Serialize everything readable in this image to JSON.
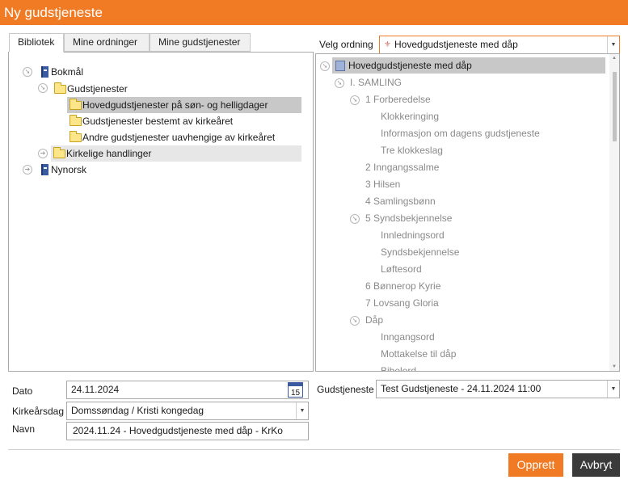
{
  "window": {
    "title": "Ny gudstjeneste"
  },
  "tabs": [
    {
      "label": "Bibliotek"
    },
    {
      "label": "Mine ordninger"
    },
    {
      "label": "Mine gudstjenester"
    }
  ],
  "library_tree": [
    {
      "label": "Bokmål"
    },
    {
      "label": "Gudstjenester"
    },
    {
      "label": "Hovedgudstjenester på søn- og helligdager"
    },
    {
      "label": "Gudstjenester bestemt av kirkeåret"
    },
    {
      "label": "Andre gudstjenester uavhengige av kirkeåret"
    },
    {
      "label": "Kirkelige handlinger"
    },
    {
      "label": "Nynorsk"
    }
  ],
  "ordning": {
    "label": "Velg ordning",
    "selected": "Hovedgudstjeneste med dåp"
  },
  "order_tree": [
    {
      "label": "Hovedgudstjeneste med dåp"
    },
    {
      "label": "I. SAMLING"
    },
    {
      "label": "1 Forberedelse"
    },
    {
      "label": "Klokkeringing"
    },
    {
      "label": "Informasjon om dagens gudstjeneste"
    },
    {
      "label": "Tre klokkeslag"
    },
    {
      "label": "2 Inngangssalme"
    },
    {
      "label": "3 Hilsen"
    },
    {
      "label": "4 Samlingsbønn"
    },
    {
      "label": "5 Syndsbekjennelse"
    },
    {
      "label": "Innledningsord"
    },
    {
      "label": "Syndsbekjennelse"
    },
    {
      "label": "Løftesord"
    },
    {
      "label": "6 Bønnerop Kyrie"
    },
    {
      "label": "7 Lovsang Gloria"
    },
    {
      "label": "Dåp"
    },
    {
      "label": "Inngangsord"
    },
    {
      "label": "Mottakelse til dåp"
    },
    {
      "label": "Bibelord"
    }
  ],
  "form": {
    "dato_label": "Dato",
    "dato_value": "24.11.2024",
    "calendar_day": "15",
    "kirkearsdag_label": "Kirkeårsdag",
    "kirkearsdag_value": "Domssøndag / Kristi kongedag",
    "navn_label": "Navn",
    "navn_value": "2024.11.24 - Hovedgudstjeneste med dåp - KrKo",
    "gudstjeneste_label": "Gudstjeneste",
    "gudstjeneste_value": "Test Gudstjeneste - 24.11.2024 11:00"
  },
  "buttons": {
    "opprett": "Opprett",
    "avbryt": "Avbryt"
  },
  "colors": {
    "accent": "#f07b24",
    "dark_button": "#3a3a3a"
  }
}
